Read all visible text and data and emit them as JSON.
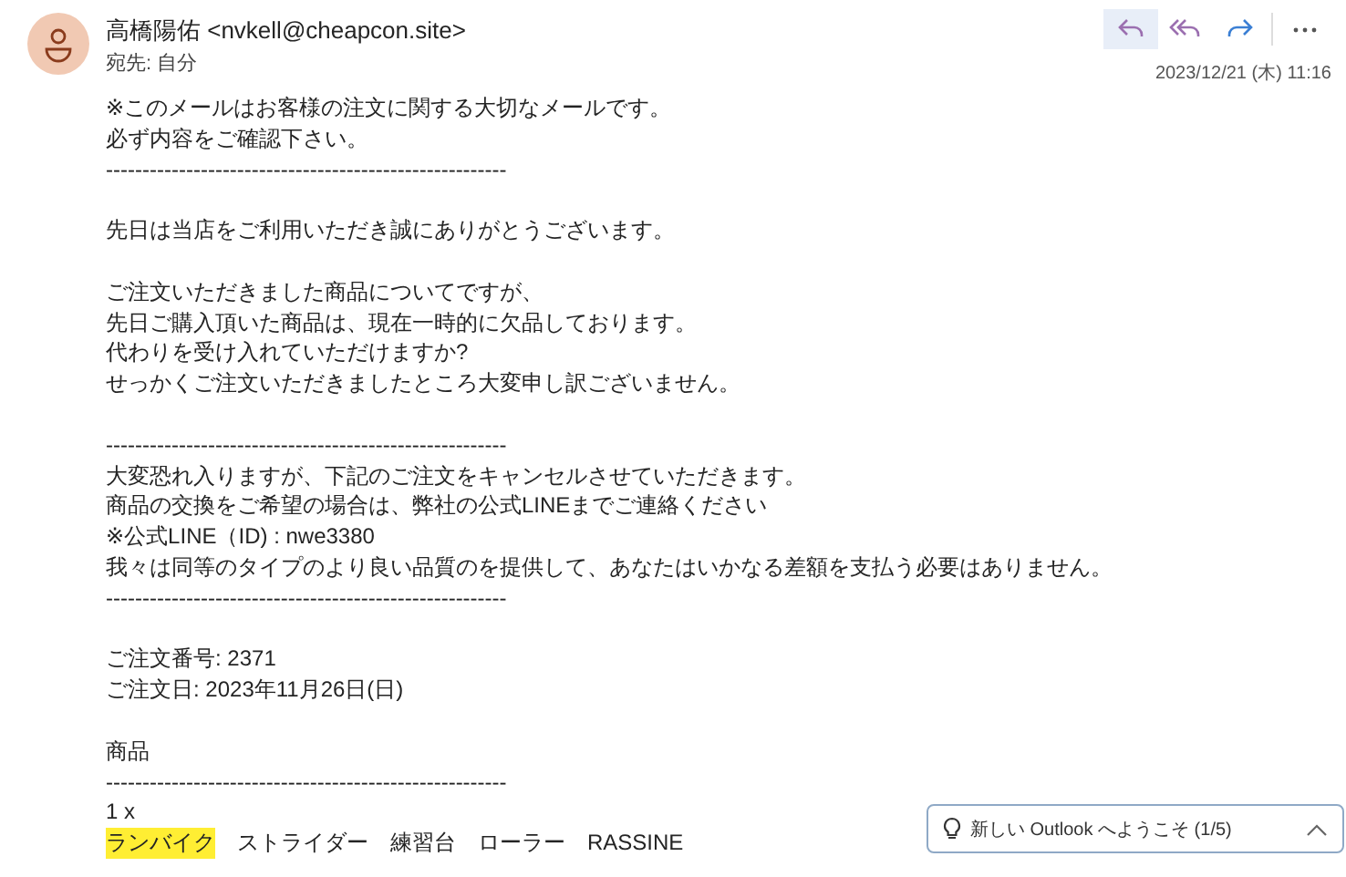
{
  "sender": {
    "name": "高橋陽佑 <nvkell@cheapcon.site>",
    "to": "宛先:  自分",
    "date": "2023/12/21 (木) 11:16"
  },
  "actions": [
    {
      "kind": "reply",
      "selected": true
    },
    {
      "kind": "reply-all",
      "selected": false
    },
    {
      "kind": "forward",
      "selected": false
    },
    {
      "kind": "more",
      "selected": false
    }
  ],
  "body": [
    {
      "kind": "text",
      "text": "※このメールはお客様の注文に関する大切なメールです。"
    },
    {
      "kind": "text",
      "text": "必ず内容をご確認下さい。"
    },
    {
      "kind": "text",
      "text": "-------------------------------------------------------"
    },
    {
      "kind": "blank"
    },
    {
      "kind": "text",
      "text": "先日は当店をご利用いただき誠にありがとうございます。"
    },
    {
      "kind": "blank"
    },
    {
      "kind": "text",
      "text": "ご注文いただきました商品についてですが、"
    },
    {
      "kind": "text",
      "text": "先日ご購入頂いた商品は、現在一時的に欠品しております。"
    },
    {
      "kind": "text",
      "text": "代わりを受け入れていただけますか?"
    },
    {
      "kind": "text",
      "text": "せっかくご注文いただきましたところ大変申し訳ございません。"
    },
    {
      "kind": "blank"
    },
    {
      "kind": "text",
      "text": "-------------------------------------------------------"
    },
    {
      "kind": "text",
      "text": "大変恐れ入りますが、下記のご注文をキャンセルさせていただきます。"
    },
    {
      "kind": "text",
      "text": "商品の交換をご希望の場合は、弊社の公式LINEまでご連絡ください"
    },
    {
      "kind": "text",
      "text": "※公式LINE（ID) : nwe3380"
    },
    {
      "kind": "text",
      "text": "我々は同等のタイプのより良い品質のを提供して、あなたはいかなる差額を支払う必要はありません。"
    },
    {
      "kind": "text",
      "text": "-------------------------------------------------------"
    },
    {
      "kind": "blank"
    },
    {
      "kind": "text",
      "text": "ご注文番号: 2371"
    },
    {
      "kind": "text",
      "text": "ご注文日: 2023年11月26日(日)"
    },
    {
      "kind": "blank"
    },
    {
      "kind": "text",
      "text": "商品"
    },
    {
      "kind": "text",
      "text": "-------------------------------------------------------"
    },
    {
      "kind": "text",
      "text": "1 x"
    },
    {
      "kind": "product",
      "parts": [
        {
          "text": "ランバイク",
          "highlighted": true
        },
        {
          "text": "ストライダー",
          "highlighted": false
        },
        {
          "text": "練習台",
          "highlighted": false
        },
        {
          "text": "ローラー",
          "highlighted": false
        },
        {
          "text": "RASSINE",
          "highlighted": false
        }
      ]
    }
  ],
  "welcome": {
    "text": "新しい Outlook へようこそ  (1/5)",
    "expanded": false
  }
}
